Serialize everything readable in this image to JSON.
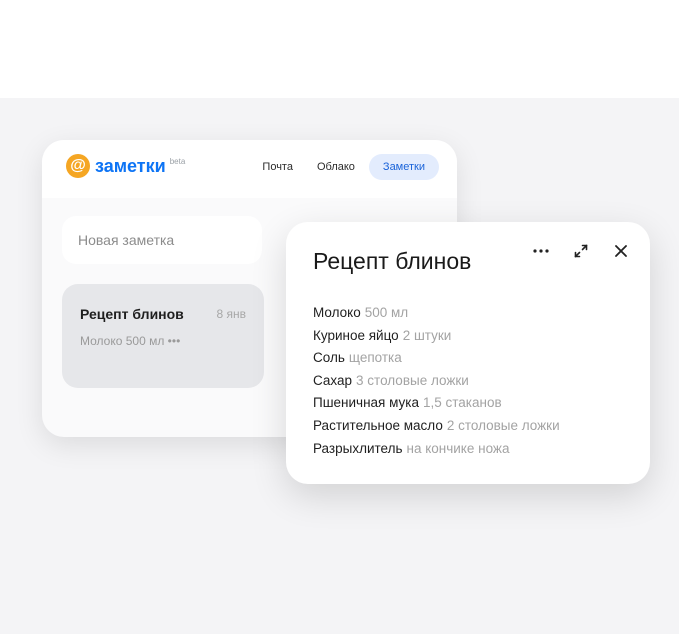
{
  "app": {
    "logo_text": "заметки",
    "logo_badge": "beta"
  },
  "nav": {
    "items": [
      {
        "label": "Почта",
        "active": false
      },
      {
        "label": "Облако",
        "active": false
      },
      {
        "label": "Заметки",
        "active": true
      }
    ]
  },
  "sidebar": {
    "new_note_placeholder": "Новая заметка",
    "notes": [
      {
        "title": "Рецепт блинов",
        "date": "8 янв",
        "preview": "Молоко 500 мл •••"
      }
    ]
  },
  "note_popup": {
    "title": "Рецепт блинов",
    "actions": [
      "more-icon",
      "expand-icon",
      "close-icon"
    ],
    "ingredients": [
      {
        "name": "Молоко",
        "qty": "500 мл"
      },
      {
        "name": "Куриное яйцо",
        "qty": "2 штуки"
      },
      {
        "name": "Соль",
        "qty": "щепотка"
      },
      {
        "name": "Сахар",
        "qty": "3 столовые ложки"
      },
      {
        "name": "Пшеничная мука",
        "qty": "1,5 стаканов"
      },
      {
        "name": "Растительное масло",
        "qty": "2 столовые ложки"
      },
      {
        "name": "Разрыхлитель",
        "qty": "на кончике ножа"
      }
    ]
  },
  "colors": {
    "brand_blue": "#0d74f5",
    "logo_orange": "#f5a623",
    "active_tab_bg": "#e3ecfd",
    "muted_text": "#a3a3a3"
  }
}
